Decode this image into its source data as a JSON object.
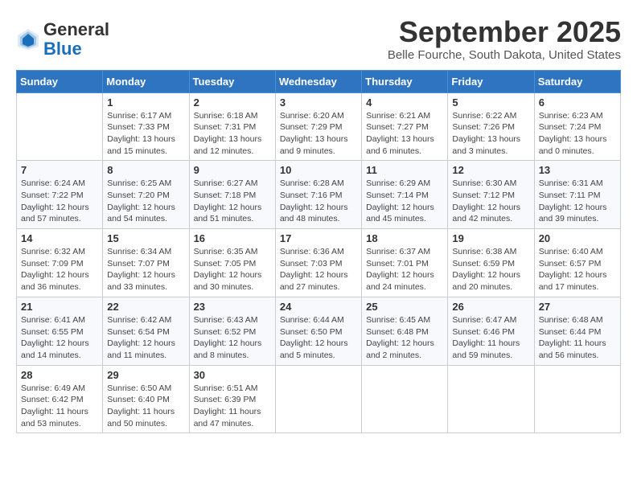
{
  "header": {
    "logo_line1": "General",
    "logo_line2": "Blue",
    "month_title": "September 2025",
    "location": "Belle Fourche, South Dakota, United States"
  },
  "weekdays": [
    "Sunday",
    "Monday",
    "Tuesday",
    "Wednesday",
    "Thursday",
    "Friday",
    "Saturday"
  ],
  "weeks": [
    [
      {
        "day": "",
        "detail": ""
      },
      {
        "day": "1",
        "detail": "Sunrise: 6:17 AM\nSunset: 7:33 PM\nDaylight: 13 hours\nand 15 minutes."
      },
      {
        "day": "2",
        "detail": "Sunrise: 6:18 AM\nSunset: 7:31 PM\nDaylight: 13 hours\nand 12 minutes."
      },
      {
        "day": "3",
        "detail": "Sunrise: 6:20 AM\nSunset: 7:29 PM\nDaylight: 13 hours\nand 9 minutes."
      },
      {
        "day": "4",
        "detail": "Sunrise: 6:21 AM\nSunset: 7:27 PM\nDaylight: 13 hours\nand 6 minutes."
      },
      {
        "day": "5",
        "detail": "Sunrise: 6:22 AM\nSunset: 7:26 PM\nDaylight: 13 hours\nand 3 minutes."
      },
      {
        "day": "6",
        "detail": "Sunrise: 6:23 AM\nSunset: 7:24 PM\nDaylight: 13 hours\nand 0 minutes."
      }
    ],
    [
      {
        "day": "7",
        "detail": "Sunrise: 6:24 AM\nSunset: 7:22 PM\nDaylight: 12 hours\nand 57 minutes."
      },
      {
        "day": "8",
        "detail": "Sunrise: 6:25 AM\nSunset: 7:20 PM\nDaylight: 12 hours\nand 54 minutes."
      },
      {
        "day": "9",
        "detail": "Sunrise: 6:27 AM\nSunset: 7:18 PM\nDaylight: 12 hours\nand 51 minutes."
      },
      {
        "day": "10",
        "detail": "Sunrise: 6:28 AM\nSunset: 7:16 PM\nDaylight: 12 hours\nand 48 minutes."
      },
      {
        "day": "11",
        "detail": "Sunrise: 6:29 AM\nSunset: 7:14 PM\nDaylight: 12 hours\nand 45 minutes."
      },
      {
        "day": "12",
        "detail": "Sunrise: 6:30 AM\nSunset: 7:12 PM\nDaylight: 12 hours\nand 42 minutes."
      },
      {
        "day": "13",
        "detail": "Sunrise: 6:31 AM\nSunset: 7:11 PM\nDaylight: 12 hours\nand 39 minutes."
      }
    ],
    [
      {
        "day": "14",
        "detail": "Sunrise: 6:32 AM\nSunset: 7:09 PM\nDaylight: 12 hours\nand 36 minutes."
      },
      {
        "day": "15",
        "detail": "Sunrise: 6:34 AM\nSunset: 7:07 PM\nDaylight: 12 hours\nand 33 minutes."
      },
      {
        "day": "16",
        "detail": "Sunrise: 6:35 AM\nSunset: 7:05 PM\nDaylight: 12 hours\nand 30 minutes."
      },
      {
        "day": "17",
        "detail": "Sunrise: 6:36 AM\nSunset: 7:03 PM\nDaylight: 12 hours\nand 27 minutes."
      },
      {
        "day": "18",
        "detail": "Sunrise: 6:37 AM\nSunset: 7:01 PM\nDaylight: 12 hours\nand 24 minutes."
      },
      {
        "day": "19",
        "detail": "Sunrise: 6:38 AM\nSunset: 6:59 PM\nDaylight: 12 hours\nand 20 minutes."
      },
      {
        "day": "20",
        "detail": "Sunrise: 6:40 AM\nSunset: 6:57 PM\nDaylight: 12 hours\nand 17 minutes."
      }
    ],
    [
      {
        "day": "21",
        "detail": "Sunrise: 6:41 AM\nSunset: 6:55 PM\nDaylight: 12 hours\nand 14 minutes."
      },
      {
        "day": "22",
        "detail": "Sunrise: 6:42 AM\nSunset: 6:54 PM\nDaylight: 12 hours\nand 11 minutes."
      },
      {
        "day": "23",
        "detail": "Sunrise: 6:43 AM\nSunset: 6:52 PM\nDaylight: 12 hours\nand 8 minutes."
      },
      {
        "day": "24",
        "detail": "Sunrise: 6:44 AM\nSunset: 6:50 PM\nDaylight: 12 hours\nand 5 minutes."
      },
      {
        "day": "25",
        "detail": "Sunrise: 6:45 AM\nSunset: 6:48 PM\nDaylight: 12 hours\nand 2 minutes."
      },
      {
        "day": "26",
        "detail": "Sunrise: 6:47 AM\nSunset: 6:46 PM\nDaylight: 11 hours\nand 59 minutes."
      },
      {
        "day": "27",
        "detail": "Sunrise: 6:48 AM\nSunset: 6:44 PM\nDaylight: 11 hours\nand 56 minutes."
      }
    ],
    [
      {
        "day": "28",
        "detail": "Sunrise: 6:49 AM\nSunset: 6:42 PM\nDaylight: 11 hours\nand 53 minutes."
      },
      {
        "day": "29",
        "detail": "Sunrise: 6:50 AM\nSunset: 6:40 PM\nDaylight: 11 hours\nand 50 minutes."
      },
      {
        "day": "30",
        "detail": "Sunrise: 6:51 AM\nSunset: 6:39 PM\nDaylight: 11 hours\nand 47 minutes."
      },
      {
        "day": "",
        "detail": ""
      },
      {
        "day": "",
        "detail": ""
      },
      {
        "day": "",
        "detail": ""
      },
      {
        "day": "",
        "detail": ""
      }
    ]
  ]
}
